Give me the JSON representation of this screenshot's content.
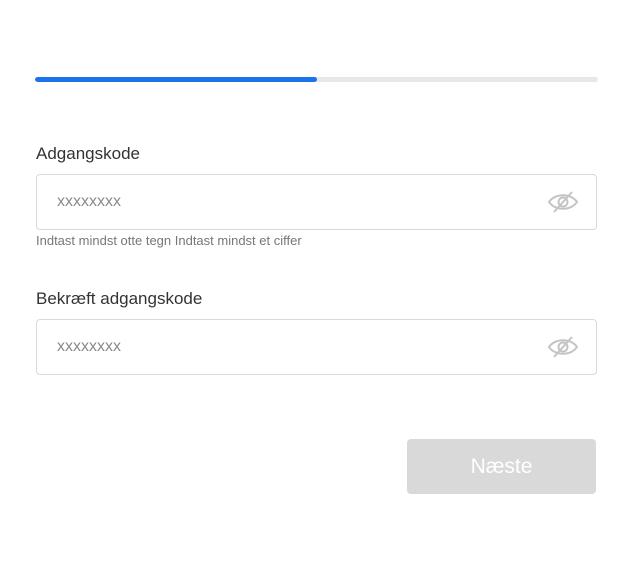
{
  "progress": {
    "fraction": 0.5,
    "fill_color": "#1a73e8",
    "track_color": "#e8e8e8"
  },
  "password": {
    "label": "Adgangskode",
    "placeholder": "xxxxxxxx",
    "value": "",
    "icon": "eye-slash-icon",
    "hint": "Indtast mindst otte tegn Indtast mindst et ciffer"
  },
  "confirm_password": {
    "label": "Bekræft adgangskode",
    "placeholder": "xxxxxxxx",
    "value": "",
    "icon": "eye-slash-icon"
  },
  "next_button": {
    "label": "Næste",
    "enabled": false,
    "background": "#d9d9d9"
  }
}
